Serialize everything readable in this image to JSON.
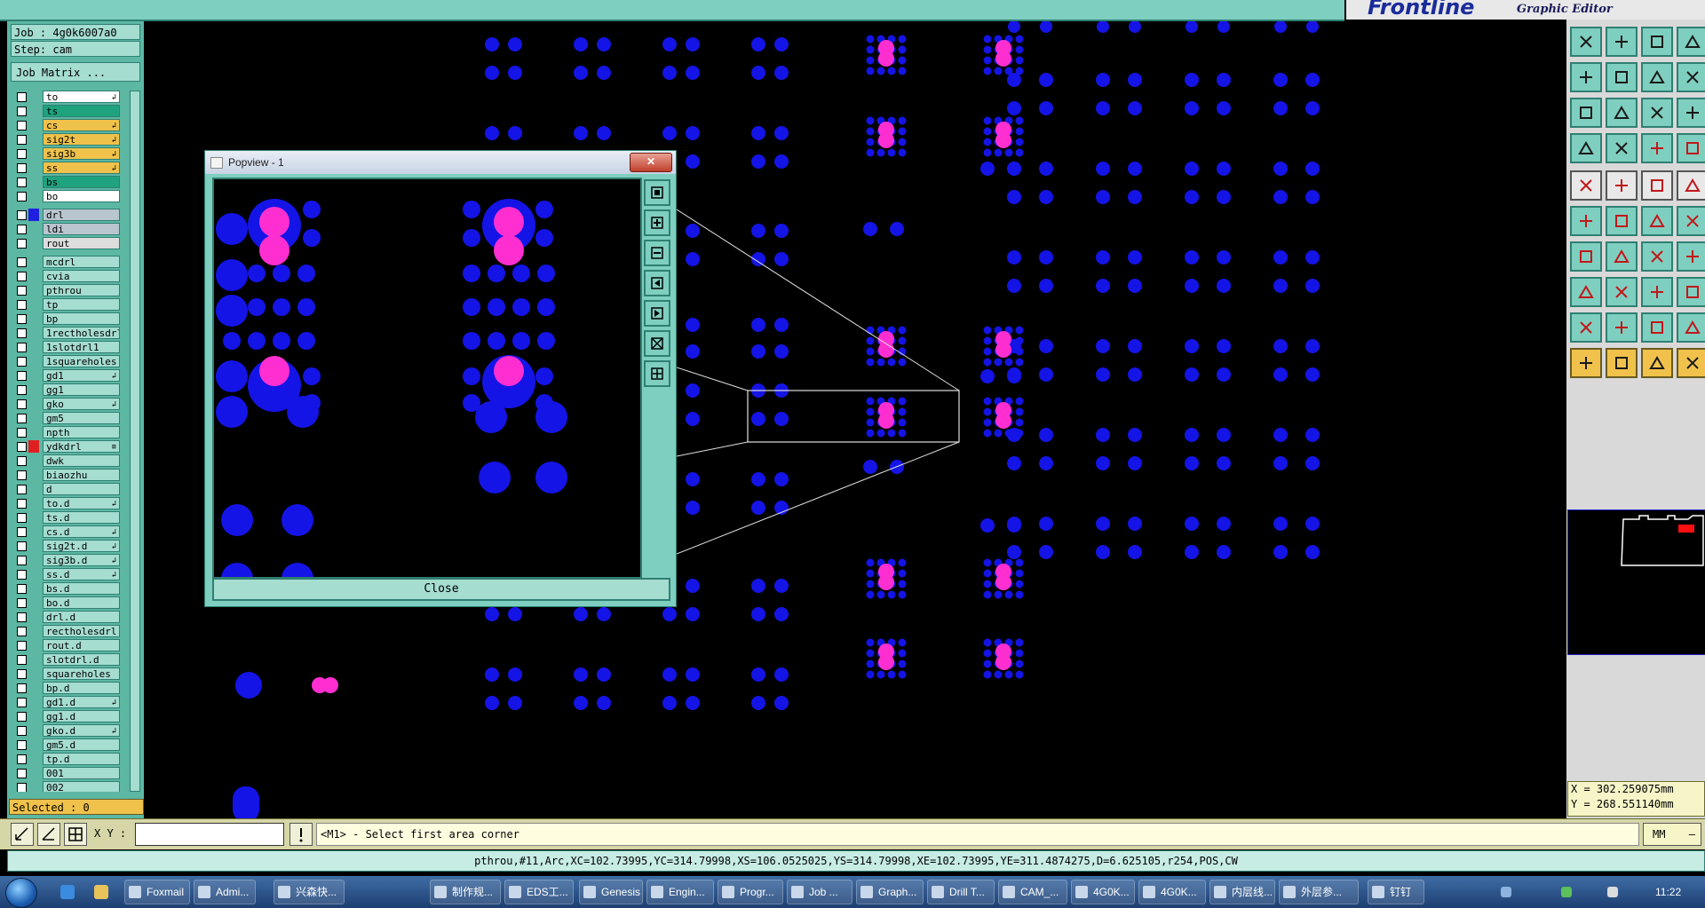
{
  "app": {
    "brand": "Frontline",
    "subtitle": "Graphic Editor"
  },
  "job": {
    "job_label": "Job : 4g0k6007a0",
    "step_label": "Step: cam",
    "matrix_button": "Job Matrix ..."
  },
  "layers": [
    {
      "name": "to",
      "color": "#ffffff",
      "flag": "↲"
    },
    {
      "name": "ts",
      "color": "#1fa37e",
      "flag": ""
    },
    {
      "name": "cs",
      "color": "#f0c24b",
      "flag": "↲"
    },
    {
      "name": "sig2t",
      "color": "#f0c24b",
      "flag": "↲"
    },
    {
      "name": "sig3b",
      "color": "#f0c24b",
      "flag": "↲"
    },
    {
      "name": "ss",
      "color": "#f0c24b",
      "flag": "↲"
    },
    {
      "name": "bs",
      "color": "#1fa37e",
      "flag": ""
    },
    {
      "name": "bo",
      "color": "#ffffff",
      "flag": ""
    },
    {
      "name": "drl",
      "color": "#b9c6cf",
      "flag": "",
      "mark": "#2020e0"
    },
    {
      "name": "ldi",
      "color": "#b9c6cf",
      "flag": ""
    },
    {
      "name": "rout",
      "color": "#dddddd",
      "flag": ""
    },
    {
      "name": "mcdrl",
      "color": "#a5ddd1",
      "flag": ""
    },
    {
      "name": "cvia",
      "color": "#a5ddd1",
      "flag": ""
    },
    {
      "name": "pthrou",
      "color": "#a5ddd1",
      "flag": ""
    },
    {
      "name": "tp",
      "color": "#a5ddd1",
      "flag": ""
    },
    {
      "name": "bp",
      "color": "#a5ddd1",
      "flag": ""
    },
    {
      "name": "1rectholesdrl",
      "color": "#a5ddd1",
      "flag": ""
    },
    {
      "name": "1slotdrl1",
      "color": "#a5ddd1",
      "flag": ""
    },
    {
      "name": "1squareholes",
      "color": "#a5ddd1",
      "flag": ""
    },
    {
      "name": "gd1",
      "color": "#a5ddd1",
      "flag": "↲"
    },
    {
      "name": "gg1",
      "color": "#a5ddd1",
      "flag": ""
    },
    {
      "name": "gko",
      "color": "#a5ddd1",
      "flag": "↲"
    },
    {
      "name": "gm5",
      "color": "#a5ddd1",
      "flag": ""
    },
    {
      "name": "npth",
      "color": "#a5ddd1",
      "flag": ""
    },
    {
      "name": "ydkdrl",
      "color": "#a5ddd1",
      "flag": "≡",
      "mark": "#e02020"
    },
    {
      "name": "dwk",
      "color": "#a5ddd1",
      "flag": ""
    },
    {
      "name": "biaozhu",
      "color": "#a5ddd1",
      "flag": ""
    },
    {
      "name": "d",
      "color": "#a5ddd1",
      "flag": ""
    },
    {
      "name": "to.d",
      "color": "#a5ddd1",
      "flag": "↲"
    },
    {
      "name": "ts.d",
      "color": "#a5ddd1",
      "flag": ""
    },
    {
      "name": "cs.d",
      "color": "#a5ddd1",
      "flag": "↲"
    },
    {
      "name": "sig2t.d",
      "color": "#a5ddd1",
      "flag": "↲"
    },
    {
      "name": "sig3b.d",
      "color": "#a5ddd1",
      "flag": "↲"
    },
    {
      "name": "ss.d",
      "color": "#a5ddd1",
      "flag": "↲"
    },
    {
      "name": "bs.d",
      "color": "#a5ddd1",
      "flag": ""
    },
    {
      "name": "bo.d",
      "color": "#a5ddd1",
      "flag": ""
    },
    {
      "name": "drl.d",
      "color": "#a5ddd1",
      "flag": ""
    },
    {
      "name": "rectholesdrl",
      "color": "#a5ddd1",
      "flag": ""
    },
    {
      "name": "rout.d",
      "color": "#a5ddd1",
      "flag": ""
    },
    {
      "name": "slotdrl.d",
      "color": "#a5ddd1",
      "flag": ""
    },
    {
      "name": "squareholes",
      "color": "#a5ddd1",
      "flag": ""
    },
    {
      "name": "bp.d",
      "color": "#a5ddd1",
      "flag": ""
    },
    {
      "name": "gd1.d",
      "color": "#a5ddd1",
      "flag": "↲"
    },
    {
      "name": "gg1.d",
      "color": "#a5ddd1",
      "flag": ""
    },
    {
      "name": "gko.d",
      "color": "#a5ddd1",
      "flag": "↲"
    },
    {
      "name": "gm5.d",
      "color": "#a5ddd1",
      "flag": ""
    },
    {
      "name": "tp.d",
      "color": "#a5ddd1",
      "flag": ""
    },
    {
      "name": "001",
      "color": "#a5ddd1",
      "flag": ""
    },
    {
      "name": "002",
      "color": "#a5ddd1",
      "flag": ""
    }
  ],
  "selected_label": "Selected : 0",
  "popview": {
    "title": "Popview - 1",
    "close_label": "Close",
    "close_x": "✕"
  },
  "input": {
    "xy_label": "X Y :",
    "xy_value": "",
    "message": "<M1> - Select first area corner",
    "units": "MM"
  },
  "coords": {
    "x": "X =  302.259075mm",
    "y": "Y =  268.551140mm"
  },
  "status_line": "pthrou,#11,Arc,XC=102.73995,YC=314.79998,XS=106.0525025,YS=314.79998,XE=102.73995,YE=311.4874275,D=6.625105,r254,POS,CW",
  "taskbar": {
    "items": [
      "Foxmail",
      "Admi...",
      "兴森快...",
      "制作规...",
      "EDS工...",
      "Genesis",
      "Engin...",
      "Progr...",
      "Job ...",
      "Graph...",
      "Drill T...",
      "CAM_...",
      "4G0K...",
      "4G0K...",
      "内层线...",
      "外层参...",
      "钉钉"
    ],
    "clock": "11:22"
  },
  "colors": {
    "teal": "#7fcfc0",
    "pad_blue": "#1414e6",
    "pad_magenta": "#ff2ed1",
    "yellow": "#f0c24b"
  }
}
